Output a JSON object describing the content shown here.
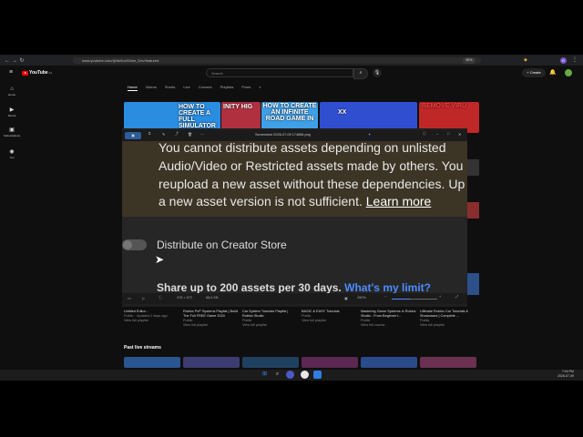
{
  "browser": {
    "url": "www.youtube.com/@ItsSunShine_Dev/featured",
    "zoom": "90%",
    "profile_initial": "R"
  },
  "youtube": {
    "logo": "YouTube",
    "region": "CA",
    "search_placeholder": "Search",
    "create_label": "Create",
    "rail": [
      {
        "label": "Home",
        "icon": "home-icon"
      },
      {
        "label": "Shorts",
        "icon": "shorts-icon"
      },
      {
        "label": "Subscriptions",
        "icon": "subscriptions-icon"
      },
      {
        "label": "You",
        "icon": "you-icon"
      }
    ],
    "tabs": [
      "Home",
      "Videos",
      "Shorts",
      "Live",
      "Courses",
      "Playlists",
      "Posts"
    ],
    "thumbnails": [
      {
        "text": "HOW TO CREATE A FULL SIMULATOR GAME",
        "bg": "#2a8de0"
      },
      {
        "text": "INITY HIG",
        "bg": "#b03040"
      },
      {
        "text": "HOW TO CREATE AN INFINITE ROAD GAME IN",
        "bg": "#3fa0e8"
      },
      {
        "text": "XX",
        "bg": "#2f4fd0"
      },
      {
        "text": "REMOVE VIRU",
        "bg": "#c02828"
      }
    ],
    "video_titles": [
      {
        "title": "Untitled Editor...",
        "meta": "Public · Updated 2 days ago",
        "link": "View full playlist"
      },
      {
        "title": "Roblox PvP Systems Playlist | Build The Full FREE Game 2024",
        "meta": "Public",
        "link": "View full playlist"
      },
      {
        "title": "Car System Tutorials Playlist | Roblox Studio",
        "meta": "Public",
        "link": "View full playlist"
      },
      {
        "title": "BASIC & EASY Tutorials",
        "meta": "Public",
        "link": "View full playlist"
      },
      {
        "title": "Mastering Game Systems in Roblox Studio - From Beginner t...",
        "meta": "Public",
        "link": "View full course"
      },
      {
        "title": "Ultimate Roblox Car Tutorials & Showcases | Complete ...",
        "meta": "Public",
        "link": "View full playlist"
      }
    ],
    "past_live": "Past live streams"
  },
  "viewer": {
    "title": "Screenshot 2026-07-09 174656.png",
    "message_lines": [
      "You cannot distribute assets depending on unlisted",
      "Audio/Video or Restricted assets made by others. You",
      "reupload a new asset without these dependencies. Up",
      "a new asset version is not sufficient."
    ],
    "learn_more": "Learn more",
    "store_label": "Distribute on Creator Store",
    "share_text": "Share up to 200 assets per 30 days.",
    "share_link": "What's my limit?",
    "status_dims": "378 × 572",
    "status_size": "68.6 KB",
    "zoom": "250%"
  },
  "taskbar": {
    "time": "7:04 PM",
    "date": "2026-07-09"
  },
  "colors": {
    "youtube_bg": "#0f0f0f",
    "viewer_banner": "#3c3425",
    "link_blue": "#4c8dff",
    "youtube_red": "#ff0000"
  }
}
